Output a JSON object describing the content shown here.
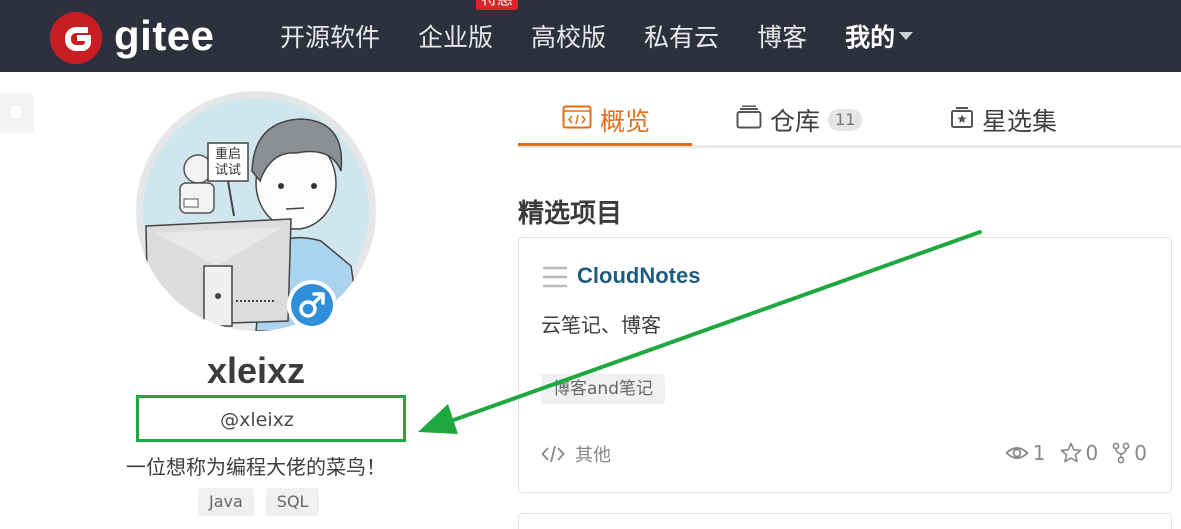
{
  "brand": {
    "name": "gitee",
    "logo_letter": "G",
    "color": "#c71d23"
  },
  "nav": {
    "items": [
      {
        "label": "开源软件",
        "active": false
      },
      {
        "label": "企业版",
        "active": false,
        "badge": "特惠"
      },
      {
        "label": "高校版",
        "active": false
      },
      {
        "label": "私有云",
        "active": false
      },
      {
        "label": "博客",
        "active": false
      },
      {
        "label": "我的",
        "active": true,
        "dropdown": true
      }
    ]
  },
  "profile": {
    "display_name": "xleixz",
    "handle": "@xleixz",
    "bio": "一位想称为编程大佬的菜鸟！",
    "gender": "male",
    "avatar_sign_text": "重启\n试试",
    "skills": [
      "Java",
      "SQL"
    ]
  },
  "tabs": [
    {
      "label": "概览",
      "icon": "code-icon",
      "active": true
    },
    {
      "label": "仓库",
      "icon": "repo-stack-icon",
      "count": "11"
    },
    {
      "label": "星选集",
      "icon": "star-collection-icon"
    }
  ],
  "featured": {
    "title": "精选项目",
    "projects": [
      {
        "name": "CloudNotes",
        "description": "云笔记、博客",
        "tag": "博客and笔记",
        "language": "其他",
        "watches": "1",
        "stars": "0",
        "forks": "0"
      }
    ]
  },
  "colors": {
    "nav_bg": "#2e313d",
    "accent": "#e56d17",
    "repo_link": "#1f5c80",
    "annotation": "#20a840",
    "gender_badge": "#2f8fdb"
  }
}
